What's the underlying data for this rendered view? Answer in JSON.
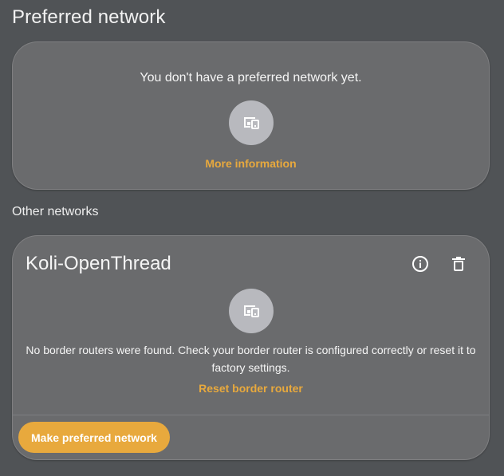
{
  "page_title": "Preferred network",
  "preferred": {
    "empty_text": "You don't have a preferred network yet.",
    "icon": "router-devices-icon",
    "more_info_label": "More information"
  },
  "other_networks_label": "Other networks",
  "network": {
    "name": "Koli-OpenThread",
    "icon": "router-devices-icon",
    "info_icon": "info-icon",
    "delete_icon": "trash-icon",
    "message": "No border routers were found. Check your border router is configured correctly or reset it to factory settings.",
    "reset_label": "Reset border router",
    "make_preferred_label": "Make preferred network"
  },
  "colors": {
    "background": "#505356",
    "card": "#6a6b6d",
    "accent": "#e8a93d",
    "icon_circle": "#b8b9be"
  }
}
